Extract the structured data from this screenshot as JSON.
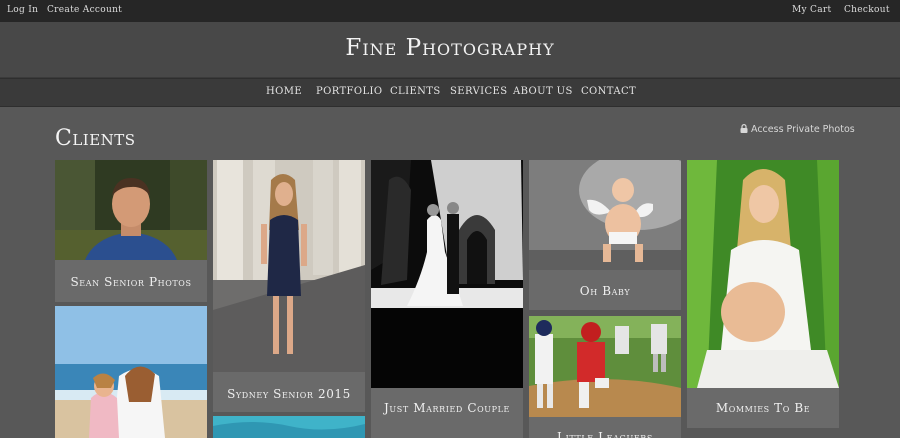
{
  "topbar": {
    "login": "Log In",
    "create_account": "Create Account",
    "cart": "My Cart",
    "checkout": "Checkout"
  },
  "site": {
    "title": "Fine Photography"
  },
  "nav": [
    "HOME",
    "PORTFOLIO",
    "CLIENTS",
    "SERVICES",
    "ABOUT US",
    "CONTACT"
  ],
  "page": {
    "heading": "Clients",
    "private_link": "Access Private Photos"
  },
  "galleries": [
    {
      "caption": "Sean Senior Photos"
    },
    {
      "caption": "Sydney Senior 2015"
    },
    {
      "caption": "Just Married Couple"
    },
    {
      "caption": "Oh Baby"
    },
    {
      "caption": "Little Leaguers"
    },
    {
      "caption": "Mommies To Be"
    }
  ],
  "colors": {
    "topbar": "#262626",
    "title_band": "#484848",
    "nav_band": "#3a3a3a",
    "page_bg": "#585858",
    "caption_bg": "#6a6a6a"
  },
  "icons": {
    "private_link": "lock-icon"
  }
}
